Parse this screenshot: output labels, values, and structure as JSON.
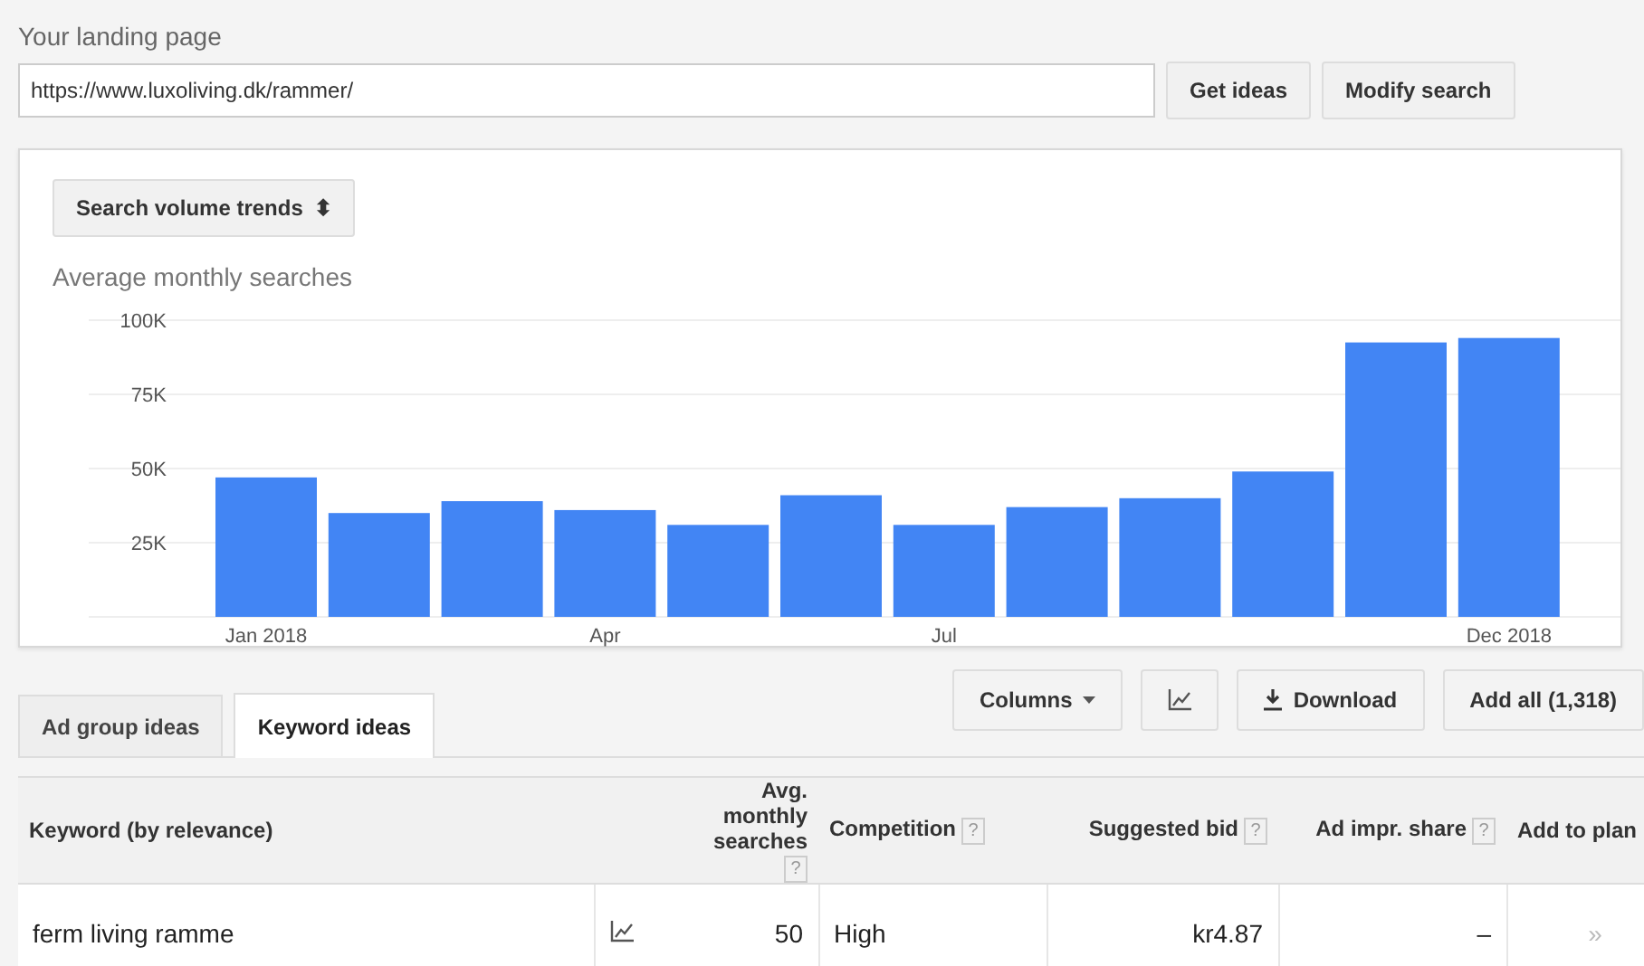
{
  "landing_page": {
    "label": "Your landing page",
    "value": "https://www.luxoliving.dk/rammer/"
  },
  "search_buttons": [
    "Get ideas",
    "Modify search"
  ],
  "trend_panel": {
    "selector": "Search volume trends",
    "selector_icon": "⬍",
    "chart_data": {
      "type": "bar",
      "grid": true,
      "title": "Average monthly searches",
      "categories": [
        "Jan 2018",
        null,
        null,
        "Apr",
        null,
        null,
        "Jul",
        null,
        null,
        null,
        null,
        "Dec 2018"
      ],
      "series": [
        {
          "color": "#4285f4",
          "values": [
            47000,
            35000,
            39000,
            36000,
            31000,
            41000,
            31000,
            37000,
            40000,
            49000,
            92500,
            94000
          ]
        }
      ],
      "ylim": [
        0,
        100000
      ],
      "yticks": [
        {
          "value": 25000,
          "label": "25K"
        },
        {
          "value": 50000,
          "label": "50K"
        },
        {
          "value": 75000,
          "label": "75K"
        },
        {
          "value": 100000,
          "label": "100K"
        }
      ]
    }
  },
  "tabs": [
    {
      "label": "Ad group ideas",
      "selected": false
    },
    {
      "label": "Keyword ideas",
      "selected": true
    }
  ],
  "toolbar": [
    {
      "kind": "dropdown",
      "label": "Columns"
    },
    {
      "kind": "chart"
    },
    {
      "kind": "download",
      "label": "Download"
    },
    {
      "kind": "plain",
      "label": "Add all (1,318)"
    }
  ],
  "table": {
    "columns": [
      {
        "label": "Keyword (by relevance)"
      },
      {},
      {
        "label": "Avg. monthly searches",
        "help": "?"
      },
      {
        "label": "Competition",
        "help": "?"
      },
      {
        "label": "Suggested bid",
        "help": "?"
      },
      {
        "label": "Ad impr. share",
        "help": "?"
      },
      {
        "label": "Add to plan"
      }
    ],
    "rows": [
      {
        "keyword": "ferm living ramme",
        "searches": "50",
        "competition": "High",
        "bid": "kr4.87",
        "impr_share": "–",
        "add": "»"
      }
    ]
  }
}
